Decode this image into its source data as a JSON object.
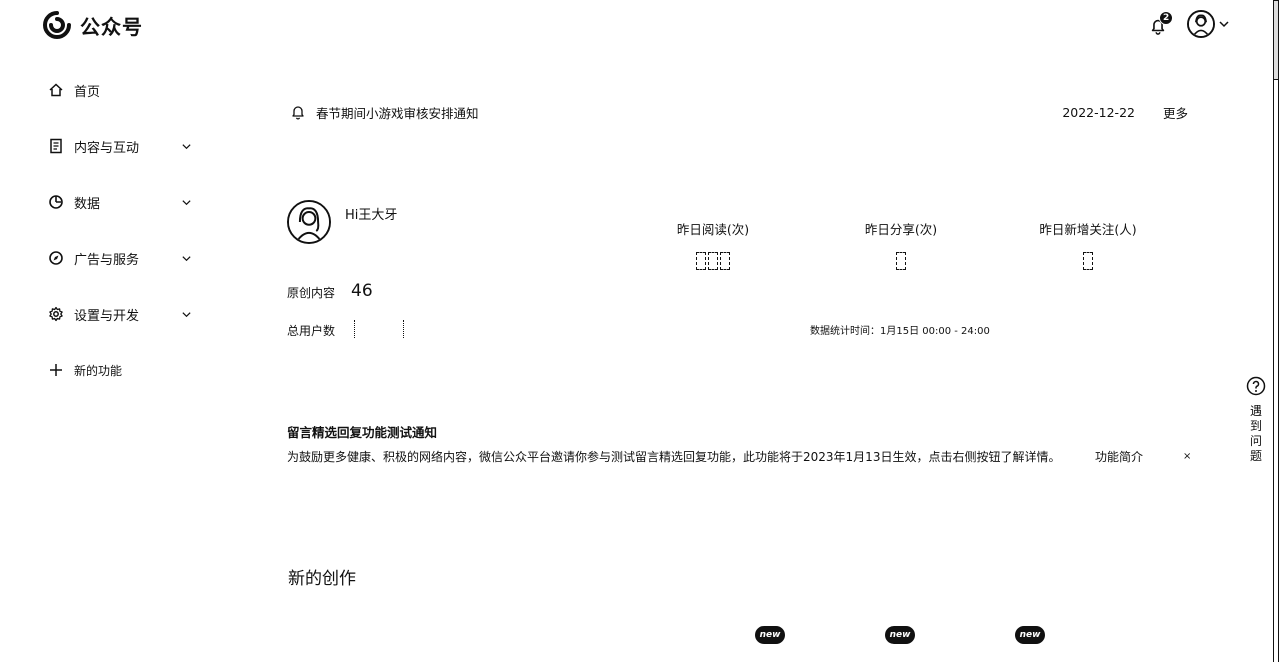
{
  "app": {
    "title": "公众号"
  },
  "header": {
    "notification_count": "2"
  },
  "sidebar": {
    "items": [
      {
        "label": "首页",
        "icon": "home-icon"
      },
      {
        "label": "内容与互动",
        "icon": "document-icon"
      },
      {
        "label": "数据",
        "icon": "pie-chart-icon"
      },
      {
        "label": "广告与服务",
        "icon": "compass-icon"
      },
      {
        "label": "设置与开发",
        "icon": "gear-icon"
      },
      {
        "label": "新的功能",
        "icon": "plus-icon"
      }
    ]
  },
  "notice": {
    "title": "春节期间小游戏审核安排通知",
    "date": "2022-12-22",
    "more_label": "更多"
  },
  "profile": {
    "greeting": "Hi王大牙"
  },
  "account_stats": {
    "original_label": "原创内容",
    "original_value": "46",
    "total_users_label": "总用户数"
  },
  "metrics": [
    {
      "label": "昨日阅读(次)"
    },
    {
      "label": "昨日分享(次)"
    },
    {
      "label": "昨日新增关注(人)"
    }
  ],
  "stat_time": "数据统计时间：1月15日 00:00 - 24:00",
  "feature_notice": {
    "title": "留言精选回复功能测试通知",
    "body": "为鼓励更多健康、积极的网络内容，微信公众平台邀请你参与测试留言精选回复功能，此功能将于2023年1月13日生效，点击右侧按钮了解详情。",
    "link_label": "功能简介",
    "close_label": "×"
  },
  "creation": {
    "section_title": "新的创作",
    "badges": [
      "new",
      "new",
      "new"
    ]
  },
  "help": {
    "label": "遇到问题"
  }
}
